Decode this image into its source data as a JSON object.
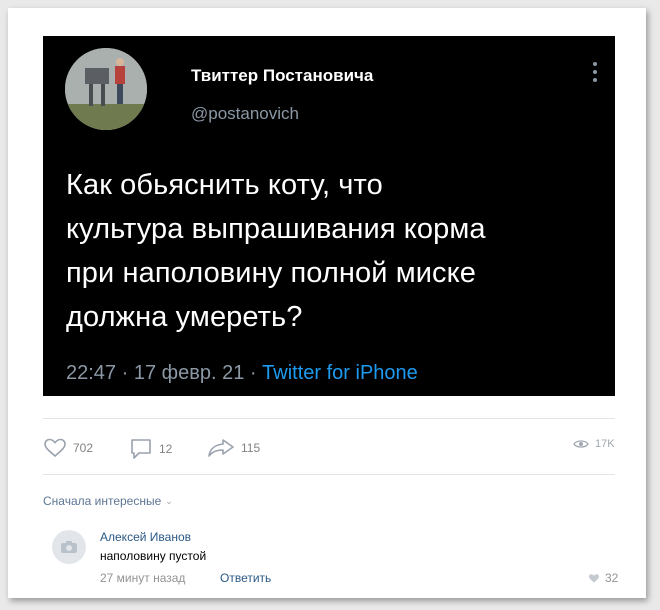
{
  "tweet": {
    "author_name": "Твиттер Постановича",
    "author_handle": "@postanovich",
    "text": "Как обьяснить коту, что\nкультура выпрашивания корма\nпри наполовину полной миске\nдолжна умереть?",
    "time": "22:47",
    "date": "17 февр. 21",
    "source": "Twitter for iPhone",
    "separator": "·"
  },
  "post_actions": {
    "likes": "702",
    "comments": "12",
    "shares": "115",
    "views": "17K"
  },
  "comments": {
    "sort_label": "Сначала интересные",
    "items": [
      {
        "author": "Алексей Иванов",
        "text": "наполовину пустой",
        "time": "27 минут назад",
        "reply_label": "Ответить",
        "likes": "32"
      }
    ]
  },
  "colors": {
    "tweet_bg": "#000000",
    "link_blue": "#1d9bf0",
    "vk_link": "#2a5885"
  },
  "icons": [
    "heart-icon",
    "comment-icon",
    "share-icon",
    "eye-icon",
    "camera-icon",
    "chevron-down-icon",
    "more-icon"
  ]
}
